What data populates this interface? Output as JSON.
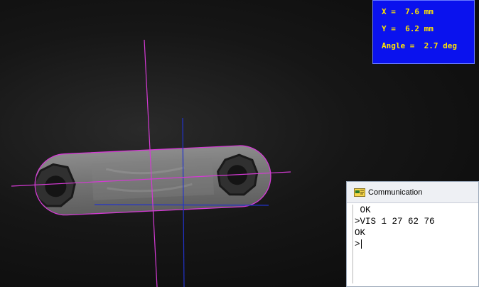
{
  "measurement": {
    "x_text": "X =  7.6 mm",
    "y_text": "Y =  6.2 mm",
    "angle_text": "Angle =  2.7 deg"
  },
  "communication": {
    "title": "Communication",
    "icon": "communication-icon",
    "lines": [
      " OK",
      ">VIS 1 27 62 76",
      "OK",
      ">"
    ]
  },
  "overlay": {
    "fit_line_color": "#d43ad4",
    "reference_line_color": "#2233cc",
    "object": "connecting-rod-part"
  }
}
